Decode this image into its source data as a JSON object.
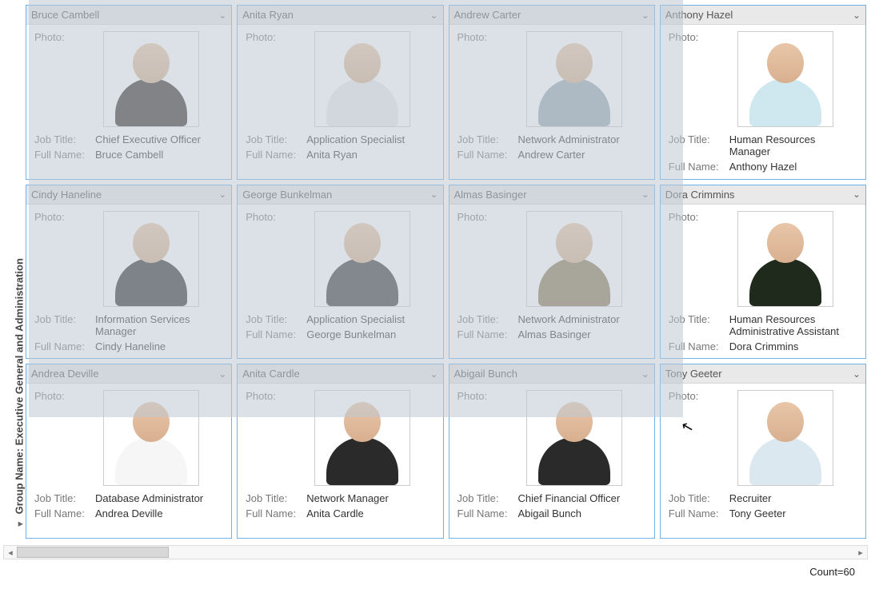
{
  "group": {
    "label_prefix": "Group Name:",
    "label_value": "Executive General and Administration"
  },
  "labels": {
    "photo": "Photo:",
    "job_title": "Job Title:",
    "full_name": "Full Name:",
    "count_label": "Count="
  },
  "footer": {
    "count": 60
  },
  "cards": [
    {
      "name": "Bruce Cambell",
      "job": "Chief Executive Officer",
      "full": "Bruce Cambell",
      "body_color": "#3a2f2b"
    },
    {
      "name": "Anita Ryan",
      "job": "Application Specialist",
      "full": "Anita Ryan",
      "body_color": "#e8e8e8"
    },
    {
      "name": "Andrew Carter",
      "job": "Network Administrator",
      "full": "Andrew Carter",
      "body_color": "#9aa6b2"
    },
    {
      "name": "Anthony Hazel",
      "job": "Human Resources Manager",
      "full": "Anthony Hazel",
      "body_color": "#cfe7ef"
    },
    {
      "name": "Cindy Haneline",
      "job": "Information Services Manager",
      "full": "Cindy Haneline",
      "body_color": "#2f2f2f"
    },
    {
      "name": "George Bunkelman",
      "job": "Application Specialist",
      "full": "George Bunkelman",
      "body_color": "#3a3a3a"
    },
    {
      "name": "Almas Basinger",
      "job": "Network Administrator",
      "full": "Almas Basinger",
      "body_color": "#8e7a5a"
    },
    {
      "name": "Dora Crimmins",
      "job": "Human Resources Administrative Assistant",
      "full": "Dora Crimmins",
      "body_color": "#1f2a1c"
    },
    {
      "name": "Andrea Deville",
      "job": "Database Administrator",
      "full": "Andrea Deville",
      "body_color": "#f6f6f6"
    },
    {
      "name": "Anita Cardle",
      "job": "Network Manager",
      "full": "Anita Cardle",
      "body_color": "#2a2a2a"
    },
    {
      "name": "Abigail Bunch",
      "job": "Chief Financial Officer",
      "full": "Abigail Bunch",
      "body_color": "#2a2a2a"
    },
    {
      "name": "Tony Geeter",
      "job": "Recruiter",
      "full": "Tony Geeter",
      "body_color": "#dce8f0"
    }
  ]
}
